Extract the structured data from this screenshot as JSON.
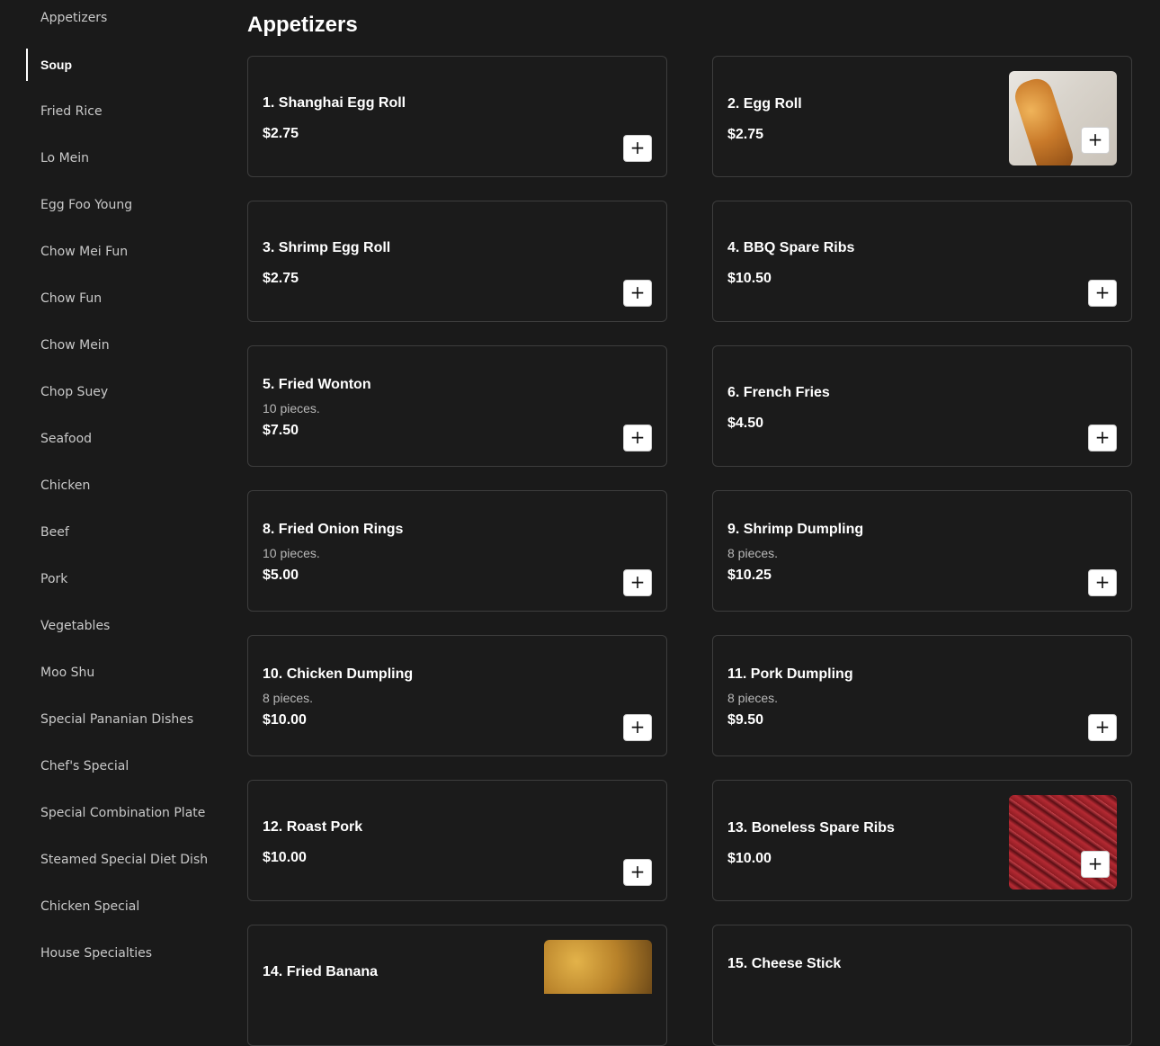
{
  "sidebar": {
    "active": "Soup",
    "items": [
      {
        "label": "Appetizers"
      },
      {
        "label": "Soup"
      },
      {
        "label": "Fried Rice"
      },
      {
        "label": "Lo Mein"
      },
      {
        "label": "Egg Foo Young"
      },
      {
        "label": "Chow Mei Fun"
      },
      {
        "label": "Chow Fun"
      },
      {
        "label": "Chow Mein"
      },
      {
        "label": "Chop Suey"
      },
      {
        "label": "Seafood"
      },
      {
        "label": "Chicken"
      },
      {
        "label": "Beef"
      },
      {
        "label": "Pork"
      },
      {
        "label": "Vegetables"
      },
      {
        "label": "Moo Shu"
      },
      {
        "label": "Special Pananian Dishes"
      },
      {
        "label": "Chef's Special"
      },
      {
        "label": "Special Combination Plate"
      },
      {
        "label": "Steamed Special Diet Dish"
      },
      {
        "label": "Chicken Special"
      },
      {
        "label": "House Specialties"
      }
    ]
  },
  "section": {
    "title": "Appetizers"
  },
  "add_symbol": "+",
  "items": [
    {
      "name": "1. Shanghai Egg Roll",
      "price": "$2.75",
      "desc": "",
      "image": ""
    },
    {
      "name": "2. Egg Roll",
      "price": "$2.75",
      "desc": "",
      "image": "egg-roll-photo"
    },
    {
      "name": "3. Shrimp Egg Roll",
      "price": "$2.75",
      "desc": "",
      "image": ""
    },
    {
      "name": "4. BBQ Spare Ribs",
      "price": "$10.50",
      "desc": "",
      "image": ""
    },
    {
      "name": "5. Fried Wonton",
      "price": "$7.50",
      "desc": "10 pieces.",
      "image": ""
    },
    {
      "name": "6. French Fries",
      "price": "$4.50",
      "desc": "",
      "image": ""
    },
    {
      "name": "8. Fried Onion Rings",
      "price": "$5.00",
      "desc": "10 pieces.",
      "image": ""
    },
    {
      "name": "9. Shrimp Dumpling",
      "price": "$10.25",
      "desc": "8 pieces.",
      "image": ""
    },
    {
      "name": "10. Chicken Dumpling",
      "price": "$10.00",
      "desc": "8 pieces.",
      "image": ""
    },
    {
      "name": "11. Pork Dumpling",
      "price": "$9.50",
      "desc": "8 pieces.",
      "image": ""
    },
    {
      "name": "12. Roast Pork",
      "price": "$10.00",
      "desc": "",
      "image": ""
    },
    {
      "name": "13. Boneless Spare Ribs",
      "price": "$10.00",
      "desc": "",
      "image": "boneless-spare-ribs-photo"
    },
    {
      "name": "14. Fried Banana",
      "price": "",
      "desc": "",
      "image": "fried-banana-photo"
    },
    {
      "name": "15. Cheese Stick",
      "price": "",
      "desc": "",
      "image": ""
    }
  ]
}
